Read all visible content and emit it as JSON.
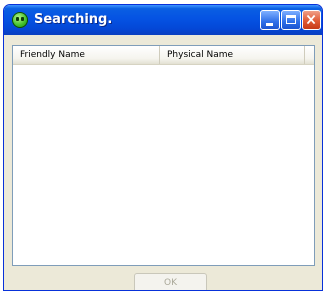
{
  "window": {
    "title": "Searching.",
    "app_icon": "green-face-icon",
    "controls": [
      "minimize-icon",
      "maximize-icon",
      "close-icon"
    ]
  },
  "listview": {
    "columns": [
      "Friendly Name",
      "Physical Name"
    ],
    "rows": []
  },
  "footer": {
    "ok_label": "OK",
    "ok_enabled": false
  },
  "colors": {
    "titlebar": "#0553e3",
    "window_body": "#ece9d8",
    "close_button": "#e05a35"
  }
}
